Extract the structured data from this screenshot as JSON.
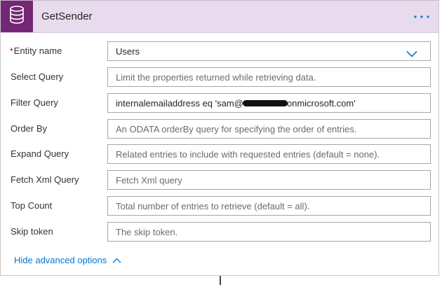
{
  "action": {
    "title": "GetSender",
    "icon": "database-icon",
    "more_icon": "ellipsis-icon",
    "accent_color": "#742774",
    "header_bg": "#e9dbee"
  },
  "fields": {
    "entity_name": {
      "required_marker": "*",
      "label": "Entity name",
      "value": "Users"
    },
    "select_query": {
      "label": "Select Query",
      "placeholder": "Limit the properties returned while retrieving data."
    },
    "filter_query": {
      "label": "Filter Query",
      "value_prefix": "internalemailaddress eq 'sam@",
      "value_suffix": "onmicrosoft.com'"
    },
    "order_by": {
      "label": "Order By",
      "placeholder": "An ODATA orderBy query for specifying the order of entries."
    },
    "expand_query": {
      "label": "Expand Query",
      "placeholder": "Related entries to include with requested entries (default = none)."
    },
    "fetch_xml_query": {
      "label": "Fetch Xml Query",
      "placeholder": "Fetch Xml query"
    },
    "top_count": {
      "label": "Top Count",
      "placeholder": "Total number of entries to retrieve (default = all)."
    },
    "skip_token": {
      "label": "Skip token",
      "placeholder": "The skip token."
    }
  },
  "advanced": {
    "toggle_label": "Hide advanced options",
    "link_color": "#0078d4"
  }
}
